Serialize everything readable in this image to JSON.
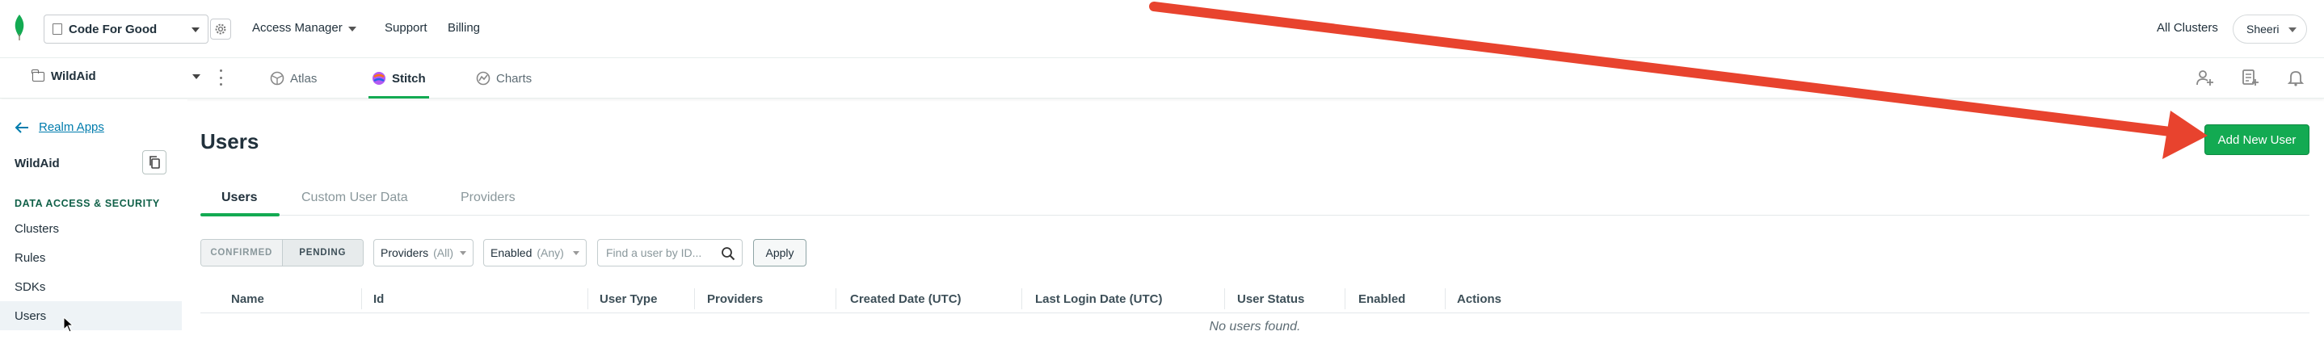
{
  "topnav": {
    "org_name": "Code For Good",
    "access_manager": "Access Manager",
    "support": "Support",
    "billing": "Billing",
    "all_clusters": "All Clusters",
    "user_name": "Sheeri"
  },
  "subnav": {
    "project_name": "WildAid",
    "tabs": [
      {
        "label": "Atlas",
        "icon": "atlas-icon"
      },
      {
        "label": "Stitch",
        "icon": "stitch-icon"
      },
      {
        "label": "Charts",
        "icon": "charts-icon"
      }
    ],
    "active_tab": "Stitch"
  },
  "sidebar": {
    "back_label": "Realm Apps",
    "app_name": "WildAid",
    "section_title": "DATA ACCESS & SECURITY",
    "items": [
      {
        "label": "Clusters"
      },
      {
        "label": "Rules"
      },
      {
        "label": "SDKs"
      },
      {
        "label": "Users"
      }
    ],
    "active_item": "Users"
  },
  "main": {
    "title": "Users",
    "add_button": "Add New User",
    "tabs": [
      {
        "label": "Users"
      },
      {
        "label": "Custom User Data"
      },
      {
        "label": "Providers"
      }
    ],
    "filters": {
      "confirmed": "CONFIRMED",
      "pending": "PENDING",
      "providers_label": "Providers",
      "providers_value": "(All)",
      "enabled_label": "Enabled",
      "enabled_value": "(Any)",
      "search_placeholder": "Find a user by ID...",
      "apply": "Apply"
    },
    "table": {
      "columns": [
        "Name",
        "Id",
        "User Type",
        "Providers",
        "Created Date (UTC)",
        "Last Login Date (UTC)",
        "User Status",
        "Enabled",
        "Actions"
      ],
      "empty_message": "No users found."
    }
  },
  "colors": {
    "accent": "#13aa52",
    "annotation_arrow": "#e8432e",
    "link": "#007cad"
  }
}
